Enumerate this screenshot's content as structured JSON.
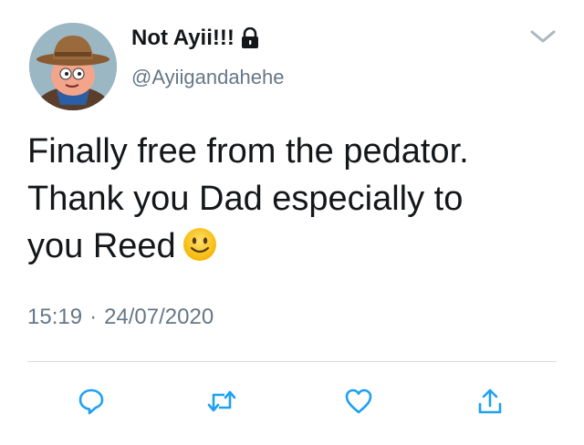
{
  "tweet": {
    "display_name": "Not Ayii!!!",
    "handle": "@Ayiigandahehe",
    "text": "Finally free from the pedator.\nThank you Dad especially to\nyou Reed",
    "time": "15:19",
    "separator": "·",
    "date": "24/07/2020"
  },
  "icons": {
    "lock": "lock-icon",
    "menu": "chevron-down-icon",
    "emoji": "slightly-smiling-face-emoji",
    "reply": "reply-icon",
    "retweet": "retweet-icon",
    "like": "heart-icon",
    "share": "share-icon"
  },
  "colors": {
    "text": "#14171a",
    "secondary": "#657786",
    "action_icon": "#1da1f2",
    "divider": "#d6dbe0"
  }
}
